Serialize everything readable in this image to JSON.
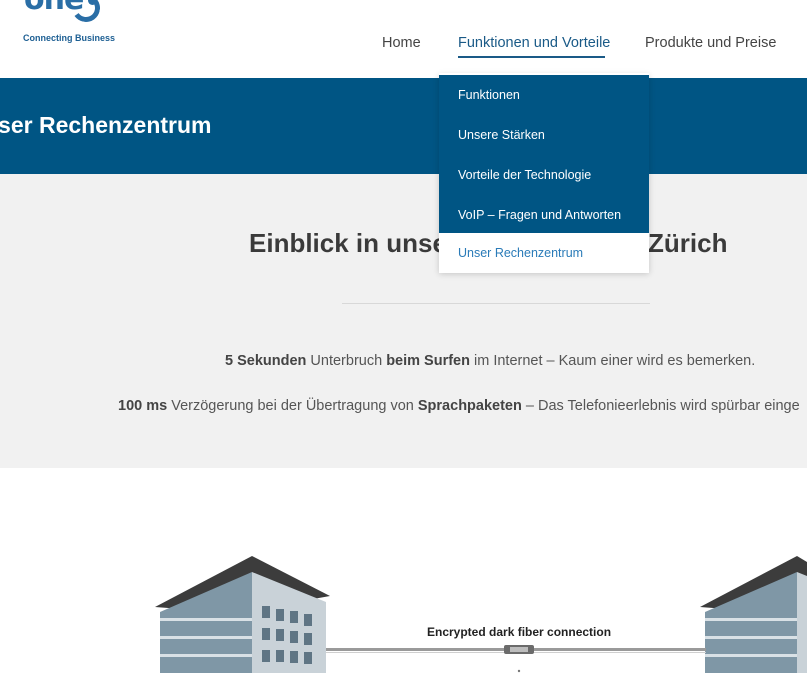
{
  "header": {
    "logo_word": "one",
    "logo_tagline": "Connecting Business",
    "nav": {
      "home": "Home",
      "features": "Funktionen und Vorteile",
      "products": "Produkte und Preise"
    }
  },
  "dropdown": {
    "items": [
      "Funktionen",
      "Unsere Stärken",
      "Vorteile der Technologie",
      "VoIP – Fragen und Antworten",
      "Unser Rechenzentrum"
    ]
  },
  "banner": {
    "title": "nser Rechenzentrum"
  },
  "section": {
    "headline_left": "Einblick in unse",
    "headline_right": "n Zürich",
    "p1": {
      "b1": "5 Sekunden",
      "t1": " Unterbruch ",
      "b2": "beim Surfen",
      "t2": " im Internet – Kaum einer wird es bemerken."
    },
    "p2": {
      "b1": "100 ms",
      "t1": " Verzögerung  bei der Übertragung von ",
      "b2": "Sprachpaketen",
      "t2": " – Das Telefonieerlebnis wird spürbar einge"
    }
  },
  "illustration": {
    "label": "Encrypted dark fiber connection"
  },
  "colors": {
    "brand_blue": "#005584",
    "logo_blue": "#2a6ea6",
    "active_link": "#2a7bb8",
    "section_gray": "#f1f1f1"
  }
}
